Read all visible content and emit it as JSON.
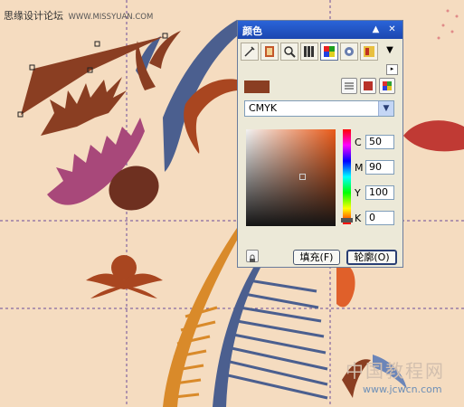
{
  "header": {
    "site_name": "思缘设计论坛",
    "site_url": "WWW.MISSYUAN.COM"
  },
  "footer_watermark": {
    "brand": "中国教程网",
    "url": "www.jcwcn.com"
  },
  "colors": {
    "background": "#f5dcc0",
    "selected_fill": "#8a3e22",
    "panel": "#ece9d8",
    "titlebar": "#2a64d8"
  },
  "panel": {
    "title": "颜色",
    "color_model": "CMYK",
    "channels": [
      {
        "label": "C",
        "value": "50"
      },
      {
        "label": "M",
        "value": "90"
      },
      {
        "label": "Y",
        "value": "100"
      },
      {
        "label": "K",
        "value": "0"
      }
    ],
    "fill_button": "填充(F)",
    "outline_button": "轮廓(O)",
    "tools": [
      "eyedropper-icon",
      "color-harmony-icon",
      "zoom-icon",
      "palette-icon",
      "color-wheel-icon",
      "fill-color-icon",
      "swatch-book-icon"
    ]
  }
}
